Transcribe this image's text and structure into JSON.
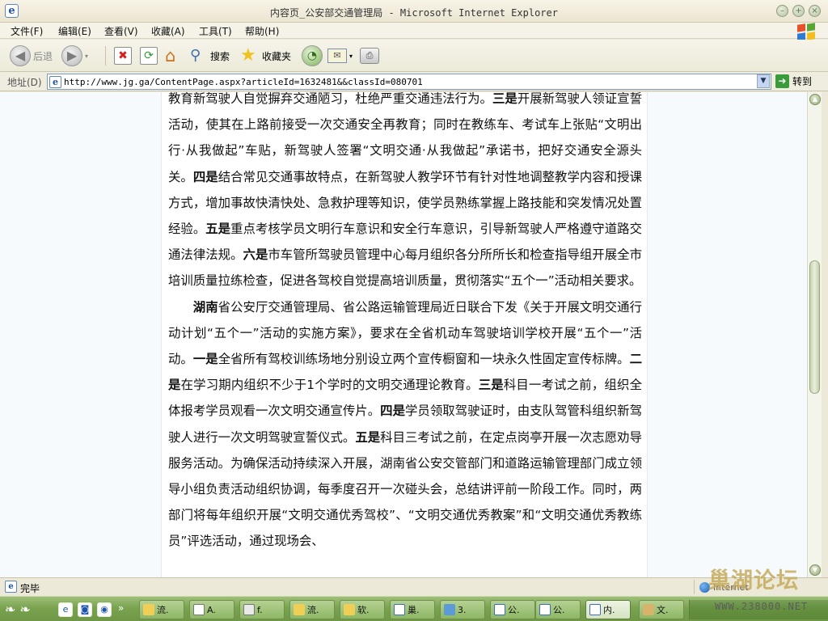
{
  "window": {
    "title": "内容页_公安部交通管理局 - Microsoft Internet Explorer"
  },
  "menu": [
    "文件(F)",
    "编辑(E)",
    "查看(V)",
    "收藏(A)",
    "工具(T)",
    "帮助(H)"
  ],
  "toolbar": {
    "back_label": "后退",
    "search_label": "搜索",
    "favorites_label": "收藏夹"
  },
  "address": {
    "label": "地址(D)",
    "url": "http://www.jg.ga/ContentPage.aspx?articleId=1632481&&classId=080701",
    "go_label": "转到"
  },
  "article": {
    "para1": {
      "t1": "教育新驾驶人自觉摒弃交通陋习，杜绝严重交通违法行为。",
      "b1": "三是",
      "t2": "开展新驾驶人领证宣誓活动，使其在上路前接受一次交通安全再教育；同时在教练车、考试车上张贴“文明出行·从我做起”车贴，新驾驶人签署“文明交通·从我做起”承诺书，把好交通安全源头关。",
      "b2": "四是",
      "t3": "结合常见交通事故特点，在新驾驶人教学环节有针对性地调整教学内容和授课方式，增加事故快清快处、急救护理等知识，使学员熟练掌握上路技能和突发情况处置经验。",
      "b3": "五是",
      "t4": "重点考核学员文明行车意识和安全行车意识，引导新驾驶人严格遵守道路交通法律法规。",
      "b4": "六是",
      "t5": "市车管所驾驶员管理中心每月组织各分所所长和检查指导组开展全市培训质量拉练检查，促进各驾校自觉提高培训质量，贯彻落实“五个一”活动相关要求。"
    },
    "para2": {
      "b0": "湖南",
      "t0": "省公安厅交通管理局、省公路运输管理局近日联合下发《关于开展文明交通行动计划“五个一”活动的实施方案》，要求在全省机动车驾驶培训学校开展“五个一”活动。",
      "b1": "一是",
      "t1": "全省所有驾校训练场地分别设立两个宣传橱窗和一块永久性固定宣传标牌。",
      "b2": "二是",
      "t2": "在学习期内组织不少于1个学时的文明交通理论教育。",
      "b3": "三是",
      "t3": "科目一考试之前，组织全体报考学员观看一次文明交通宣传片。",
      "b4": "四是",
      "t4": "学员领取驾驶证时，由支队驾管科组织新驾驶人进行一次文明驾驶宣誓仪式。",
      "b5": "五是",
      "t5": "科目三考试之前，在定点岗亭开展一次志愿劝导服务活动。为确保活动持续深入开展，湖南省公安交管部门和道路运输管理部门成立领导小组负责活动组织协调，每季度召开一次碰头会，总结讲评前一阶段工作。同时，两部门将每年组织开展“文明交通优秀驾校”、“文明交通优秀教案”和“文明交通优秀教练员”评选活动，通过现场会、"
    }
  },
  "status": {
    "text": "完毕",
    "zone": "Internet"
  },
  "watermark": {
    "text": "巢湖论坛",
    "url": "WWW.238000.NET"
  },
  "taskbar": {
    "tasks": [
      "流.",
      "A.",
      "f.",
      "流.",
      "软.",
      "巢.",
      "3.",
      "公.",
      "公.",
      "内.",
      "文."
    ]
  }
}
